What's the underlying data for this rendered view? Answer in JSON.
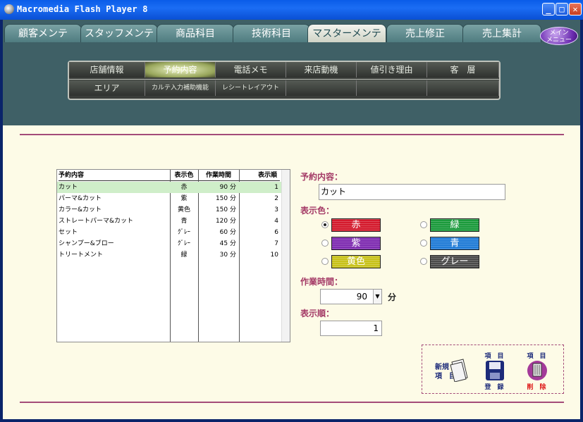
{
  "window": {
    "title": "Macromedia Flash Player 8"
  },
  "main_tabs": [
    "顧客メンテ",
    "スタッフメンテ",
    "商品科目",
    "技術科目",
    "マスターメンテ",
    "売上修正",
    "売上集計"
  ],
  "menu_button": "メイン\nメニュー",
  "sub_nav": {
    "row1": [
      "店舗情報",
      "予約内容",
      "電話メモ",
      "来店動機",
      "値引き理由",
      "客　層"
    ],
    "row2": [
      "エリア",
      "カルテ入力補助機能",
      "レシートレイアウト",
      "",
      "",
      ""
    ]
  },
  "table": {
    "headers": [
      "予約内容",
      "表示色",
      "作業時間",
      "表示順"
    ],
    "rows": [
      {
        "name": "カット",
        "color": "赤",
        "time": "90 分",
        "order": "1"
      },
      {
        "name": "パーマ&カット",
        "color": "紫",
        "time": "150 分",
        "order": "2"
      },
      {
        "name": "カラー&カット",
        "color": "黄色",
        "time": "150 分",
        "order": "3"
      },
      {
        "name": "ストレートパーマ&カット",
        "color": "青",
        "time": "120 分",
        "order": "4"
      },
      {
        "name": "セット",
        "color": "ｸﾞﾚｰ",
        "time": "60 分",
        "order": "6"
      },
      {
        "name": "シャンプー&ブロー",
        "color": "ｸﾞﾚｰ",
        "time": "45 分",
        "order": "7"
      },
      {
        "name": "トリートメント",
        "color": "緑",
        "time": "30 分",
        "order": "10"
      }
    ]
  },
  "form": {
    "content_label": "予約内容：",
    "content_value": "カット",
    "color_label": "表示色：",
    "colors": [
      {
        "name": "赤",
        "hex": "#d4192c",
        "selected": true
      },
      {
        "name": "緑",
        "hex": "#1a9a3b",
        "selected": false
      },
      {
        "name": "紫",
        "hex": "#7d2ab0",
        "selected": false
      },
      {
        "name": "青",
        "hex": "#1e7ad6",
        "selected": false
      },
      {
        "name": "黄色",
        "hex": "#c8c21a",
        "selected": false
      },
      {
        "name": "グレー",
        "hex": "#4a4a4a",
        "selected": false
      }
    ],
    "time_label": "作業時間：",
    "time_value": "90",
    "time_unit": "分",
    "order_label": "表示順：",
    "order_value": "1"
  },
  "actions": {
    "new": {
      "top": "新規",
      "bottom": "項　目"
    },
    "save": {
      "top": "項　目",
      "bottom": "登　録"
    },
    "delete": {
      "top": "項　目",
      "bottom": "削　除"
    }
  }
}
